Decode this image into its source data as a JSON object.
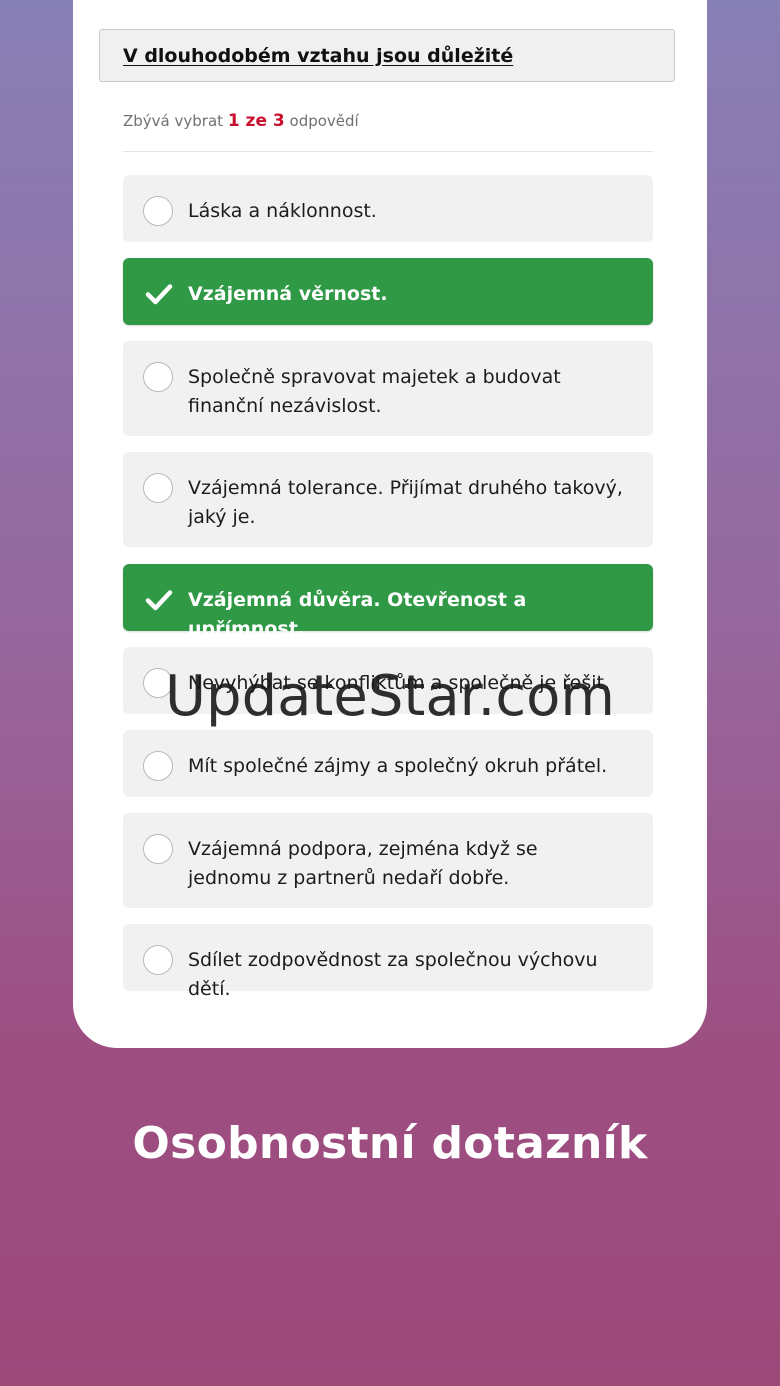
{
  "question": {
    "title": "V dlouhodobém vztahu jsou důležité"
  },
  "remaining": {
    "prefix": "Zbývá vybrat",
    "count": "1 ze 3",
    "suffix": "odpovědí"
  },
  "answers": [
    {
      "label": "Láska a náklonnost.",
      "selected": false
    },
    {
      "label": "Vzájemná věrnost.",
      "selected": true
    },
    {
      "label": "Společně spravovat majetek a budovat finanční nezávislost.",
      "selected": false
    },
    {
      "label": "Vzájemná tolerance. Přijímat druhého takový, jaký je.",
      "selected": false
    },
    {
      "label": "Vzájemná důvěra. Otevřenost a upřímnost.",
      "selected": true
    },
    {
      "label": "Nevyhýbat se konfliktům a společně je řešit.",
      "selected": false
    },
    {
      "label": "Mít společné zájmy a společný okruh přátel.",
      "selected": false
    },
    {
      "label": "Vzájemná podpora, zejména když se jednomu z partnerů nedaří dobře.",
      "selected": false
    },
    {
      "label": "Sdílet zodpovědnost za společnou výchovu dětí.",
      "selected": false
    }
  ],
  "footer": {
    "title": "Osobnostní dotazník"
  },
  "watermark": "UpdateStar.com",
  "colors": {
    "selected": "#2f9945",
    "unselected": "#f1f1f1",
    "accent_number": "#c8102e"
  }
}
